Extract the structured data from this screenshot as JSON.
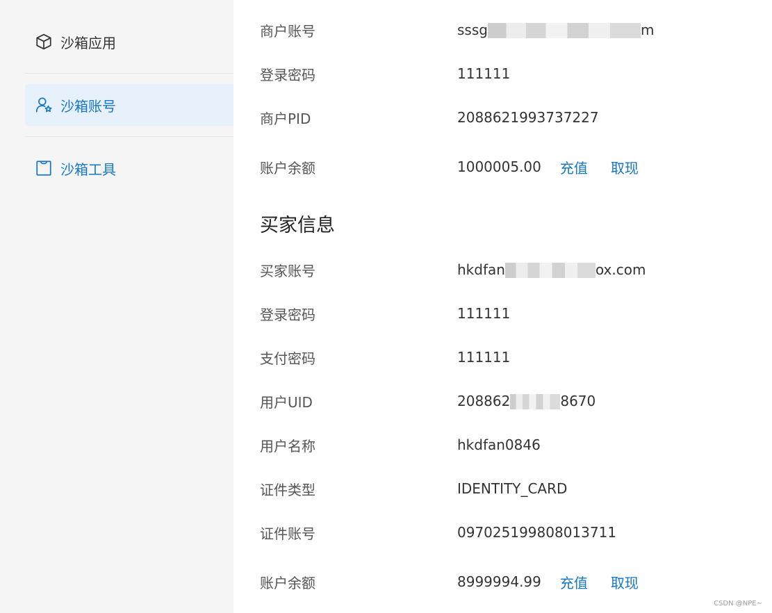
{
  "sidebar": {
    "items": [
      {
        "label": "沙箱应用",
        "icon": "cube-icon"
      },
      {
        "label": "沙箱账号",
        "icon": "user-star-icon",
        "active": true
      },
      {
        "label": "沙箱工具",
        "icon": "bag-icon"
      }
    ]
  },
  "merchant": {
    "account": {
      "label": "商户账号",
      "value_start": "sssg",
      "value_end": "m"
    },
    "password": {
      "label": "登录密码",
      "value": "111111"
    },
    "pid": {
      "label": "商户PID",
      "value": "2088621993737227"
    },
    "balance": {
      "label": "账户余额",
      "value": "1000005.00",
      "recharge": "充值",
      "withdraw": "取现"
    }
  },
  "buyer": {
    "section_title": "买家信息",
    "account": {
      "label": "买家账号",
      "value_start": "hkdfan",
      "value_end": "ox.com"
    },
    "login_password": {
      "label": "登录密码",
      "value": "111111"
    },
    "pay_password": {
      "label": "支付密码",
      "value": "111111"
    },
    "uid": {
      "label": "用户UID",
      "value_start": "208862",
      "value_end": "8670"
    },
    "username": {
      "label": "用户名称",
      "value": "hkdfan0846"
    },
    "id_type": {
      "label": "证件类型",
      "value": "IDENTITY_CARD"
    },
    "id_number": {
      "label": "证件账号",
      "value": "097025199808013711"
    },
    "balance": {
      "label": "账户余额",
      "value": "8999994.99",
      "recharge": "充值",
      "withdraw": "取现"
    }
  },
  "watermark": "CSDN @NPE~",
  "colors": {
    "accent": "#1677c9",
    "active_bg": "#e6f1fc",
    "sidebar_bg": "#f5f5f5"
  }
}
